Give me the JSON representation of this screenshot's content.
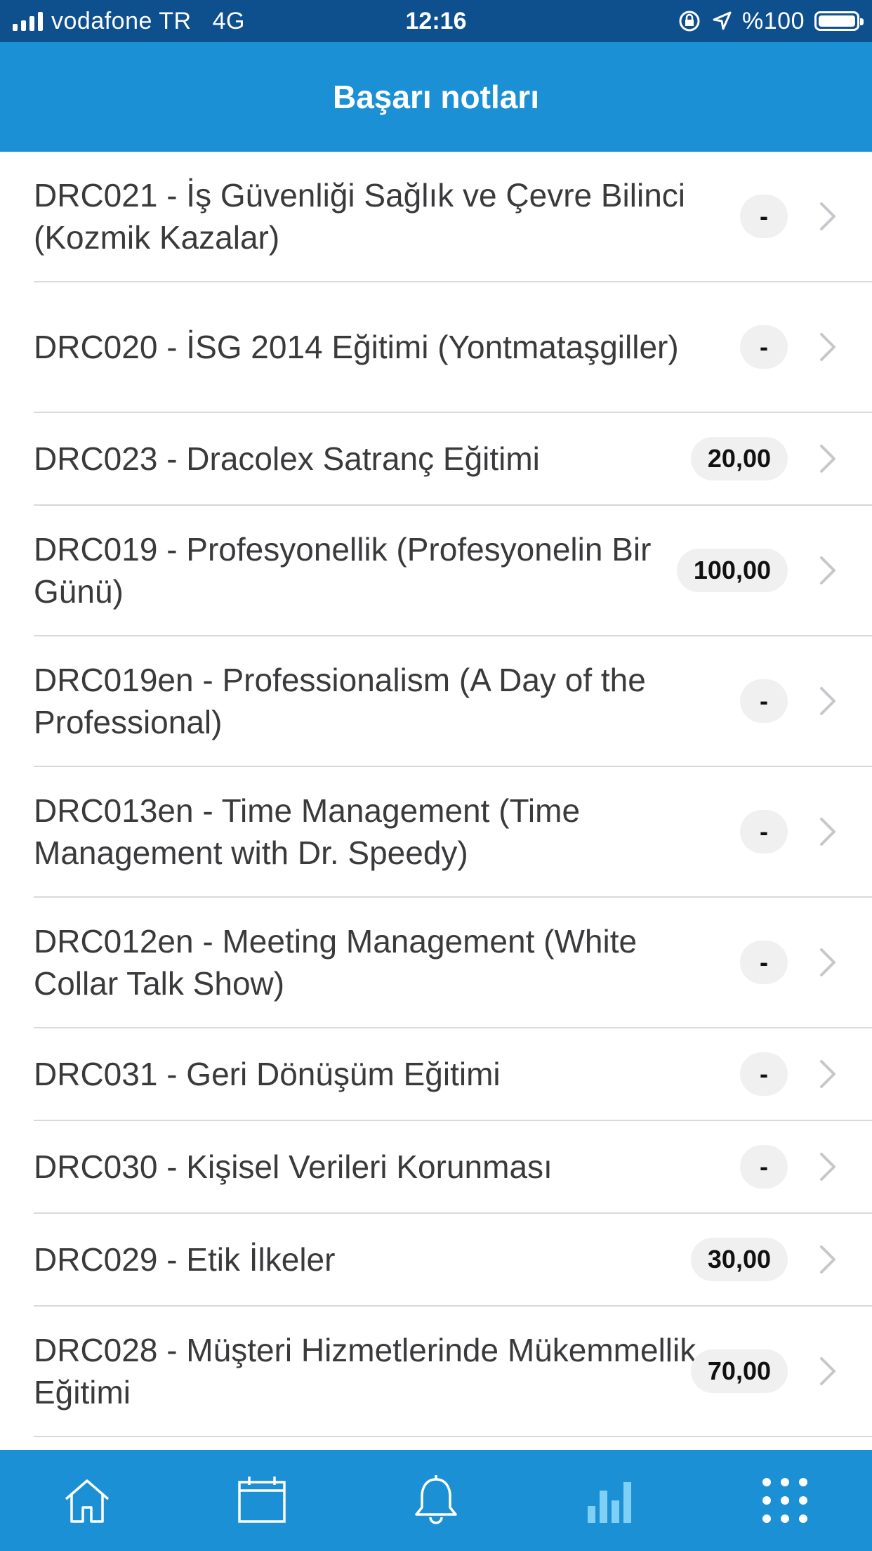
{
  "status": {
    "carrier": "vodafone TR",
    "network": "4G",
    "time": "12:16",
    "battery": "%100"
  },
  "header": {
    "title": "Başarı notları"
  },
  "items": [
    {
      "title": "DRC021 - İş Güvenliği Sağlık ve Çevre Bilinci (Kozmik Kazalar)",
      "score": "-"
    },
    {
      "title": "DRC020 - İSG 2014 Eğitimi (Yontmataşgiller)",
      "score": "-"
    },
    {
      "title": "DRC023 - Dracolex Satranç Eğitimi",
      "score": "20,00"
    },
    {
      "title": "DRC019 - Profesyonellik (Profesyonelin Bir Günü)",
      "score": "100,00"
    },
    {
      "title": "DRC019en - Professionalism (A Day of the Professional)",
      "score": "-"
    },
    {
      "title": "DRC013en - Time Management (Time Management with Dr. Speedy)",
      "score": "-"
    },
    {
      "title": "DRC012en - Meeting Management (White Collar Talk Show)",
      "score": "-"
    },
    {
      "title": "DRC031 - Geri Dönüşüm Eğitimi",
      "score": "-"
    },
    {
      "title": "DRC030 - Kişisel Verileri Korunması",
      "score": "-"
    },
    {
      "title": "DRC029 - Etik İlkeler",
      "score": "30,00"
    },
    {
      "title": "DRC028 - Müşteri Hizmetlerinde Mükemmellik Eğitimi",
      "score": "70,00"
    }
  ],
  "tabs": [
    {
      "icon": "home-icon",
      "active": false
    },
    {
      "icon": "calendar-icon",
      "active": false
    },
    {
      "icon": "bell-icon",
      "active": false
    },
    {
      "icon": "bar-chart-icon",
      "active": true
    },
    {
      "icon": "grid-menu-icon",
      "active": false
    }
  ],
  "colors": {
    "status_bar": "#0e4f8e",
    "nav_bar": "#1c90d4",
    "tab_inactive": "#ffffff",
    "tab_active": "#7fd0f4",
    "badge_bg": "#f0f0f0"
  }
}
